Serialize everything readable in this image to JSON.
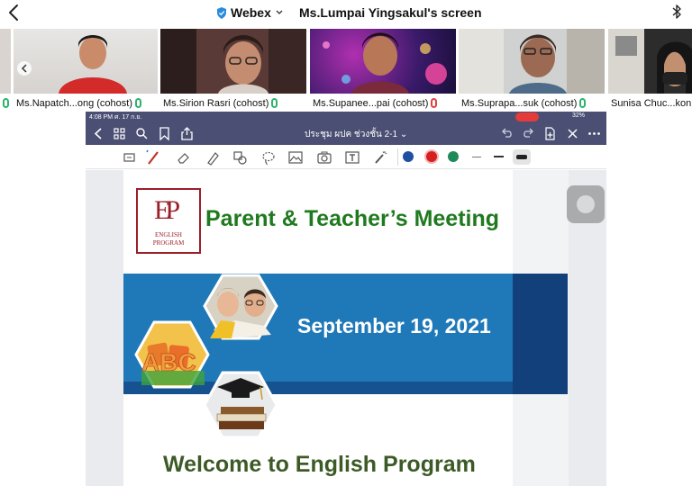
{
  "topbar": {
    "app_name": "Webex",
    "screen_title": "Ms.Lumpai Yingsakul's screen"
  },
  "participants": [
    {
      "name": "Ms.Napatch...ong (cohost)",
      "mic": "on"
    },
    {
      "name": "Ms.Sirion Rasri (cohost)",
      "mic": "on"
    },
    {
      "name": "Ms.Supanee...pai (cohost)",
      "mic": "off"
    },
    {
      "name": "Ms.Suprapa...suk (cohost)",
      "mic": "on"
    },
    {
      "name": "Sunisa Chuc...kon",
      "mic": "on"
    }
  ],
  "shared": {
    "status_time": "4:08 PM",
    "status_date": "ศ. 17 ก.ย.",
    "battery": "32%",
    "doc_title": "ประชุม ผปค ช่วงชั้น 2-1",
    "doc_title_chevron": "⌄",
    "colors": {
      "bar": "#4a4f73",
      "swatch_blue": "#1f4fa0",
      "swatch_red": "#d61f1f",
      "swatch_green": "#1e8a5a"
    }
  },
  "slide": {
    "logo_mark": "EP",
    "logo_line1": "ENGLISH",
    "logo_line2": "PROGRAM",
    "title": "Parent & Teacher’s Meeting",
    "date": "September 19, 2021",
    "welcome": "Welcome to English Program",
    "abc_text": "ABC"
  }
}
